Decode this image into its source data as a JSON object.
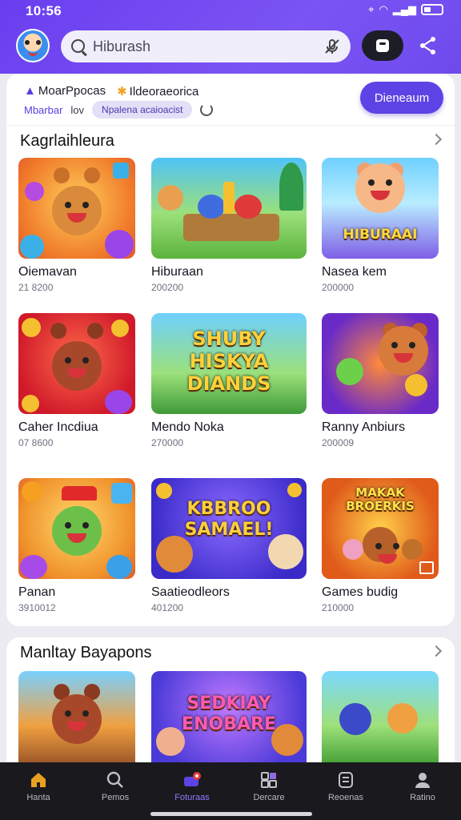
{
  "status_bar": {
    "time": "10:56"
  },
  "header": {
    "search_placeholder": "Hiburash"
  },
  "banner": {
    "item1": "MoarPpocas",
    "item2": "Ildeoraeorica",
    "sub1": "Mbarbar",
    "sub2": "lov",
    "chip": "Npalena acaioacist",
    "cta": "Dieneaum"
  },
  "section1": {
    "title": "Kagrlaihleura",
    "tiles": [
      {
        "name": "Oiemavan",
        "sub": "21 8200"
      },
      {
        "name": "Hiburaan",
        "sub": "200200"
      },
      {
        "name": "Nasea kem",
        "sub": "200000"
      },
      {
        "name": "Caher Incdiua",
        "sub": "07 8600"
      },
      {
        "name": "Mendo Noka",
        "sub": "270000"
      },
      {
        "name": "Ranny Anbiurs",
        "sub": "200009"
      },
      {
        "name": "Panan",
        "sub": "3910012"
      },
      {
        "name": "Saatieodleors",
        "sub": "401200"
      },
      {
        "name": "Games budig",
        "sub": "210000"
      }
    ],
    "thumb_texts": [
      "HIBURAAI",
      "SHUBY HISKYA DIANDS",
      "KBBROO SAMAEL!",
      "MAKAK BROERKIS"
    ]
  },
  "section2": {
    "title": "Manltay Bayapons",
    "thumb_text": "SEDKIAY ENOBARE"
  },
  "bottom_nav": [
    {
      "label": "Hanta",
      "icon": "home-icon"
    },
    {
      "label": "Pemos",
      "icon": "search-icon"
    },
    {
      "label": "Foturaas",
      "icon": "featured-icon"
    },
    {
      "label": "Dercare",
      "icon": "grid-icon"
    },
    {
      "label": "Reoenas",
      "icon": "library-icon"
    },
    {
      "label": "Ratino",
      "icon": "profile-icon"
    }
  ],
  "colors": {
    "accent": "#5d43e6",
    "header": "#6a3ef0",
    "nav_bg": "#1a1a1e",
    "active": "#8f7bff"
  }
}
